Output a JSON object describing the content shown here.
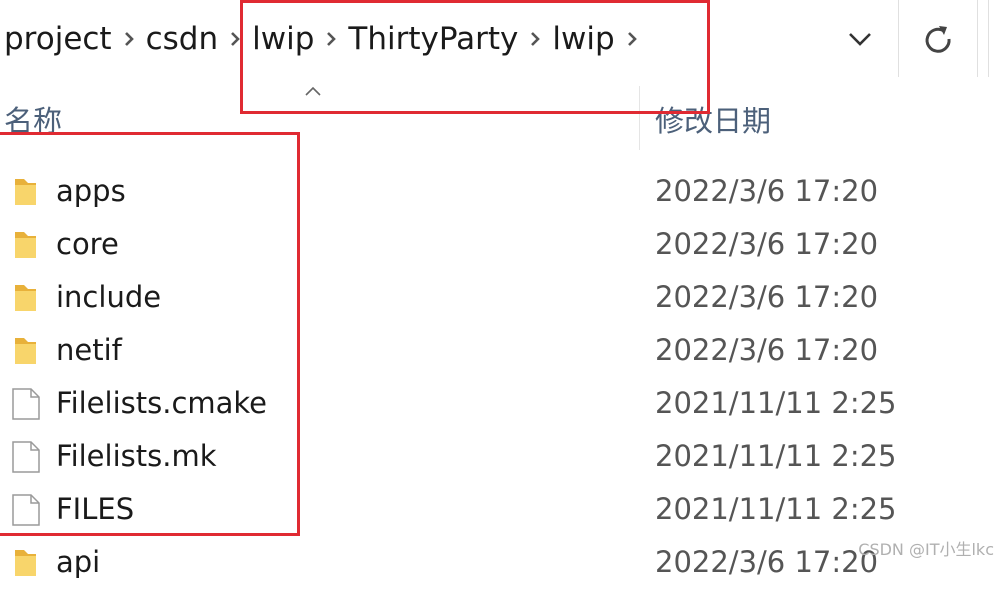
{
  "breadcrumb": {
    "items": [
      "project",
      "csdn",
      "lwip",
      "ThirtyParty",
      "lwip"
    ]
  },
  "columns": {
    "name": "名称",
    "date_modified": "修改日期"
  },
  "files": [
    {
      "name": "apps",
      "type": "folder",
      "date": "2022/3/6 17:20"
    },
    {
      "name": "core",
      "type": "folder",
      "date": "2022/3/6 17:20"
    },
    {
      "name": "include",
      "type": "folder",
      "date": "2022/3/6 17:20"
    },
    {
      "name": "netif",
      "type": "folder",
      "date": "2022/3/6 17:20"
    },
    {
      "name": "Filelists.cmake",
      "type": "file",
      "date": "2021/11/11 2:25"
    },
    {
      "name": "Filelists.mk",
      "type": "file",
      "date": "2021/11/11 2:25"
    },
    {
      "name": "FILES",
      "type": "file",
      "date": "2021/11/11 2:25"
    },
    {
      "name": "api",
      "type": "folder",
      "date": "2022/3/6 17:20"
    }
  ],
  "watermark": "CSDN @IT小生lkc",
  "icons": {
    "separator": "chevron-right-icon",
    "dropdown": "chevron-down-icon",
    "refresh": "refresh-icon",
    "folder": "folder-icon",
    "file": "file-icon"
  },
  "colors": {
    "highlight": "#e02a32",
    "folder": "#f5c84c",
    "header_text": "#4c607a"
  }
}
